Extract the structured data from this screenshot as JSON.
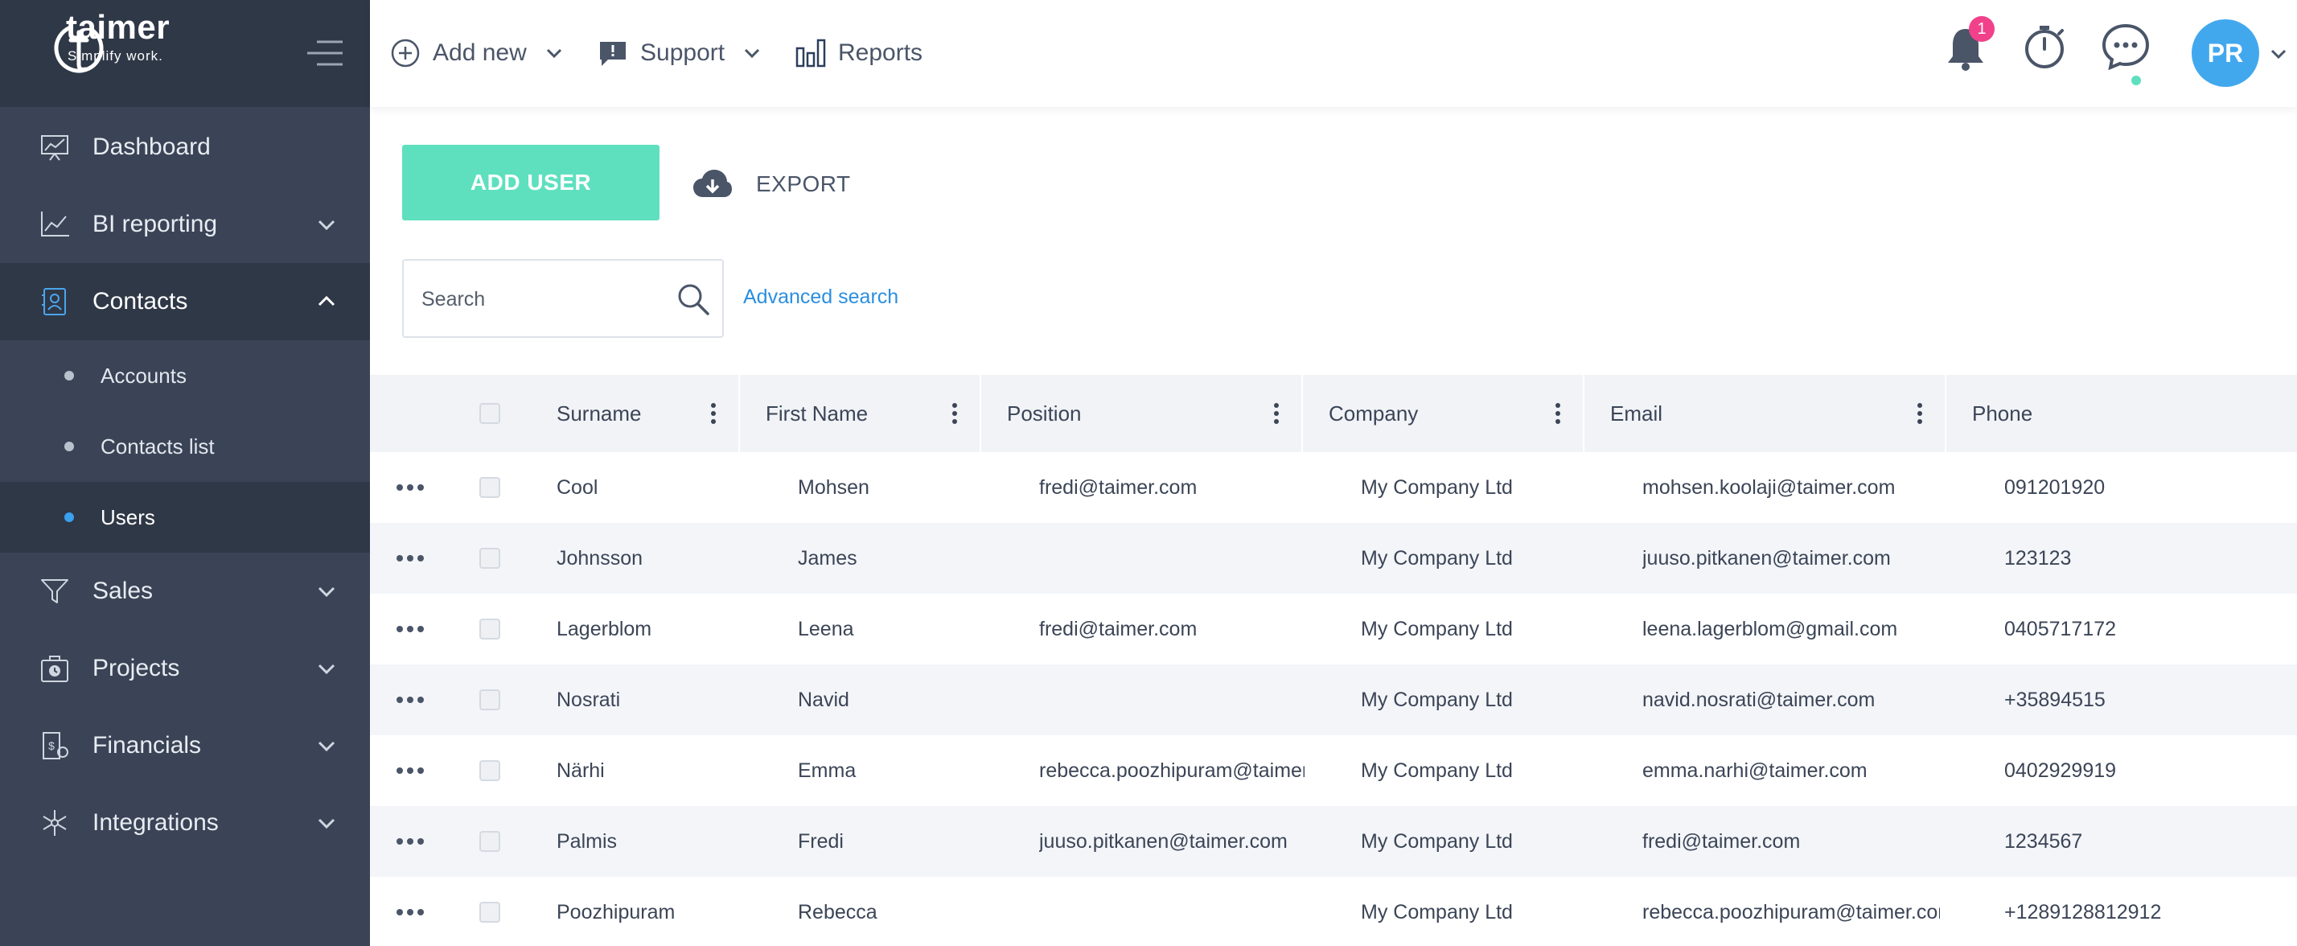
{
  "brand": {
    "name": "taimer",
    "tagline": "Simplify work."
  },
  "sidebar": {
    "items": [
      {
        "label": "Dashboard",
        "icon": "dashboard-icon"
      },
      {
        "label": "BI reporting",
        "icon": "chart-line-icon"
      },
      {
        "label": "Contacts",
        "icon": "contacts-icon"
      },
      {
        "label": "Sales",
        "icon": "funnel-icon"
      },
      {
        "label": "Projects",
        "icon": "projects-icon"
      },
      {
        "label": "Financials",
        "icon": "financials-icon"
      },
      {
        "label": "Integrations",
        "icon": "integrations-icon"
      }
    ],
    "contacts_sub": [
      {
        "label": "Accounts"
      },
      {
        "label": "Contacts list"
      },
      {
        "label": "Users"
      }
    ],
    "active_item": "Contacts",
    "active_sub": "Users"
  },
  "topbar": {
    "add_new": "Add new",
    "support": "Support",
    "reports": "Reports",
    "notification_count": "1",
    "avatar_initials": "PR"
  },
  "toolbar": {
    "add_user": "ADD USER",
    "export": "EXPORT"
  },
  "search": {
    "placeholder": "Search",
    "advanced": "Advanced search"
  },
  "table": {
    "headers": {
      "surname": "Surname",
      "first_name": "First Name",
      "position": "Position",
      "company": "Company",
      "email": "Email",
      "phone": "Phone"
    },
    "rows": [
      {
        "surname": "Cool",
        "first_name": "Mohsen",
        "position": "fredi@taimer.com",
        "company": "My Company Ltd",
        "email": "mohsen.koolaji@taimer.com",
        "phone": "091201920"
      },
      {
        "surname": "Johnsson",
        "first_name": "James",
        "position": "",
        "company": "My Company Ltd",
        "email": "juuso.pitkanen@taimer.com",
        "phone": "123123"
      },
      {
        "surname": "Lagerblom",
        "first_name": "Leena",
        "position": "fredi@taimer.com",
        "company": "My Company Ltd",
        "email": "leena.lagerblom@gmail.com",
        "phone": "0405717172"
      },
      {
        "surname": "Nosrati",
        "first_name": "Navid",
        "position": "",
        "company": "My Company Ltd",
        "email": "navid.nosrati@taimer.com",
        "phone": "+35894515"
      },
      {
        "surname": "Närhi",
        "first_name": "Emma",
        "position": "rebecca.poozhipuram@taimer....",
        "company": "My Company Ltd",
        "email": "emma.narhi@taimer.com",
        "phone": "0402929919"
      },
      {
        "surname": "Palmis",
        "first_name": "Fredi",
        "position": "juuso.pitkanen@taimer.com",
        "company": "My Company Ltd",
        "email": "fredi@taimer.com",
        "phone": "1234567"
      },
      {
        "surname": "Poozhipuram",
        "first_name": "Rebecca",
        "position": "",
        "company": "My Company Ltd",
        "email": "rebecca.poozhipuram@taimer.com",
        "phone": "+1289128812912"
      }
    ]
  },
  "colors": {
    "sidebar_bg": "#3a4456",
    "sidebar_active": "#2f3847",
    "accent_green": "#5ee0bf",
    "link_blue": "#2b8fe0",
    "avatar_blue": "#42a8ee",
    "badge_pink": "#f0418a"
  }
}
